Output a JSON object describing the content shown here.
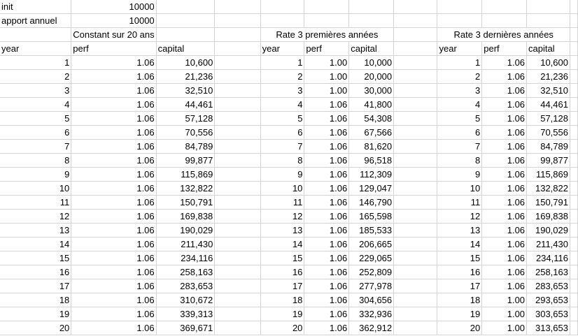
{
  "params": {
    "init_label": "init",
    "init_value": "10000",
    "apport_label": "apport annuel",
    "apport_value": "10000"
  },
  "scenario_titles": {
    "constant": "Constant sur 20 ans",
    "first3": "Rate 3 premières années",
    "last3": "Rate 3 dernières années"
  },
  "headers": {
    "year": "year",
    "perf": "perf",
    "capital": "capital"
  },
  "rows": [
    [
      "1",
      "1.06",
      "10,600",
      "1",
      "1.00",
      "10,000",
      "1",
      "1.06",
      "10,600"
    ],
    [
      "2",
      "1.06",
      "21,236",
      "2",
      "1.00",
      "20,000",
      "2",
      "1.06",
      "21,236"
    ],
    [
      "3",
      "1.06",
      "32,510",
      "3",
      "1.00",
      "30,000",
      "3",
      "1.06",
      "32,510"
    ],
    [
      "4",
      "1.06",
      "44,461",
      "4",
      "1.06",
      "41,800",
      "4",
      "1.06",
      "44,461"
    ],
    [
      "5",
      "1.06",
      "57,128",
      "5",
      "1.06",
      "54,308",
      "5",
      "1.06",
      "57,128"
    ],
    [
      "6",
      "1.06",
      "70,556",
      "6",
      "1.06",
      "67,566",
      "6",
      "1.06",
      "70,556"
    ],
    [
      "7",
      "1.06",
      "84,789",
      "7",
      "1.06",
      "81,620",
      "7",
      "1.06",
      "84,789"
    ],
    [
      "8",
      "1.06",
      "99,877",
      "8",
      "1.06",
      "96,518",
      "8",
      "1.06",
      "99,877"
    ],
    [
      "9",
      "1.06",
      "115,869",
      "9",
      "1.06",
      "112,309",
      "9",
      "1.06",
      "115,869"
    ],
    [
      "10",
      "1.06",
      "132,822",
      "10",
      "1.06",
      "129,047",
      "10",
      "1.06",
      "132,822"
    ],
    [
      "11",
      "1.06",
      "150,791",
      "11",
      "1.06",
      "146,790",
      "11",
      "1.06",
      "150,791"
    ],
    [
      "12",
      "1.06",
      "169,838",
      "12",
      "1.06",
      "165,598",
      "12",
      "1.06",
      "169,838"
    ],
    [
      "13",
      "1.06",
      "190,029",
      "13",
      "1.06",
      "185,533",
      "13",
      "1.06",
      "190,029"
    ],
    [
      "14",
      "1.06",
      "211,430",
      "14",
      "1.06",
      "206,665",
      "14",
      "1.06",
      "211,430"
    ],
    [
      "15",
      "1.06",
      "234,116",
      "15",
      "1.06",
      "229,065",
      "15",
      "1.06",
      "234,116"
    ],
    [
      "16",
      "1.06",
      "258,163",
      "16",
      "1.06",
      "252,809",
      "16",
      "1.06",
      "258,163"
    ],
    [
      "17",
      "1.06",
      "283,653",
      "17",
      "1.06",
      "277,978",
      "17",
      "1.06",
      "283,653"
    ],
    [
      "18",
      "1.06",
      "310,672",
      "18",
      "1.06",
      "304,656",
      "18",
      "1.00",
      "293,653"
    ],
    [
      "19",
      "1.06",
      "339,313",
      "19",
      "1.06",
      "332,936",
      "19",
      "1.00",
      "303,653"
    ],
    [
      "20",
      "1.06",
      "369,671",
      "20",
      "1.06",
      "362,912",
      "20",
      "1.00",
      "313,653"
    ]
  ]
}
